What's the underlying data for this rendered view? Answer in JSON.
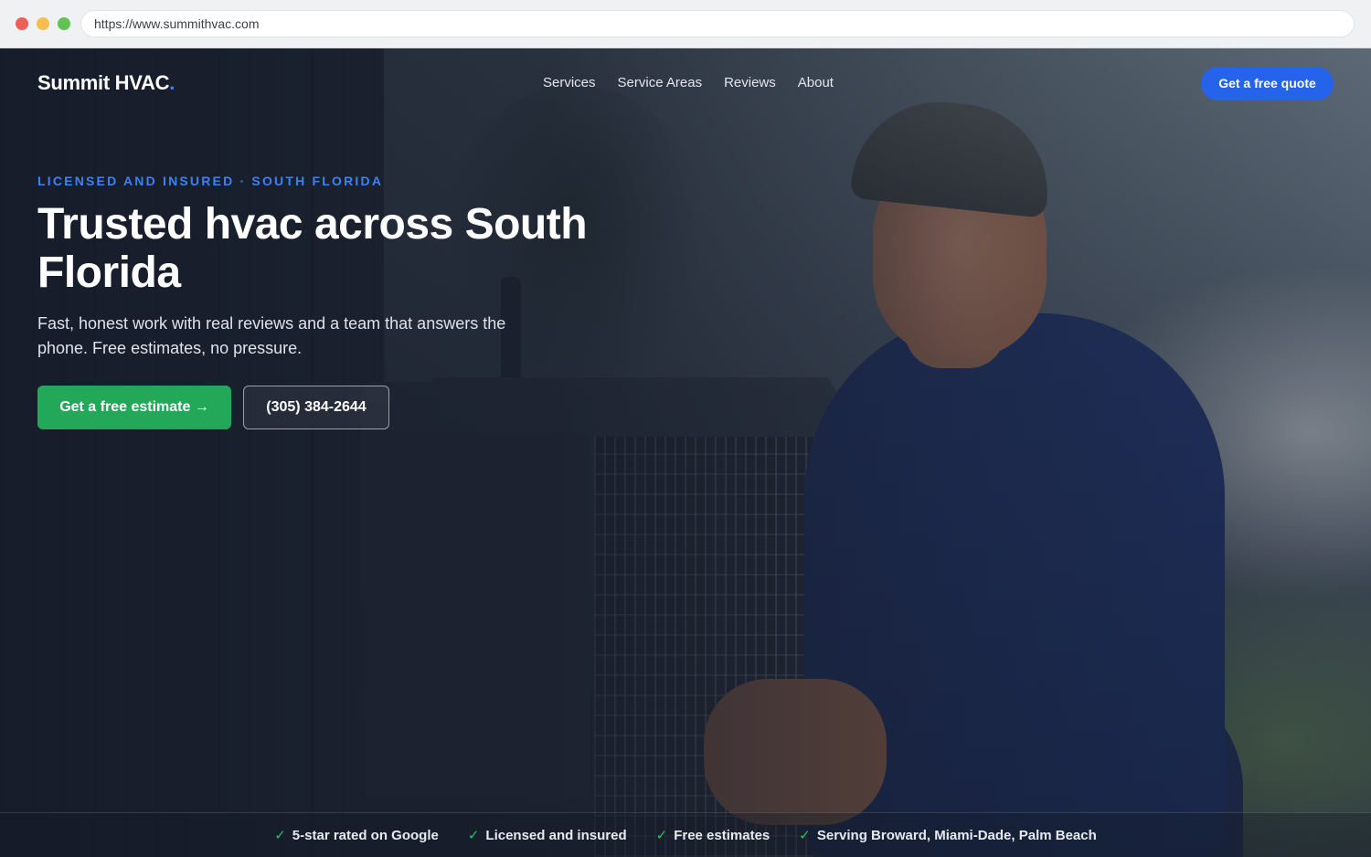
{
  "browser": {
    "url": "https://www.summithvac.com"
  },
  "header": {
    "logo_text": "Summit HVAC",
    "logo_dot": ".",
    "nav": [
      {
        "label": "Services"
      },
      {
        "label": "Service Areas"
      },
      {
        "label": "Reviews"
      },
      {
        "label": "About"
      }
    ],
    "cta_label": "Get a free quote"
  },
  "hero": {
    "eyebrow": "LICENSED AND INSURED · SOUTH FLORIDA",
    "headline": "Trusted hvac across South Florida",
    "subtext": "Fast, honest work with real reviews and a team that answers the phone. Free estimates, no pressure.",
    "primary_button": "Get a free estimate →",
    "phone_button": "(305) 384-2644"
  },
  "trust_bar": {
    "check_glyph": "✓",
    "items": [
      "5-star rated on Google",
      "Licensed and insured",
      "Free estimates",
      "Serving Broward, Miami-Dade, Palm Beach"
    ]
  },
  "colors": {
    "accent_blue": "#2563eb",
    "eyebrow_blue": "#3b82f6",
    "cta_green": "#22a858",
    "check_green": "#22c55e"
  }
}
